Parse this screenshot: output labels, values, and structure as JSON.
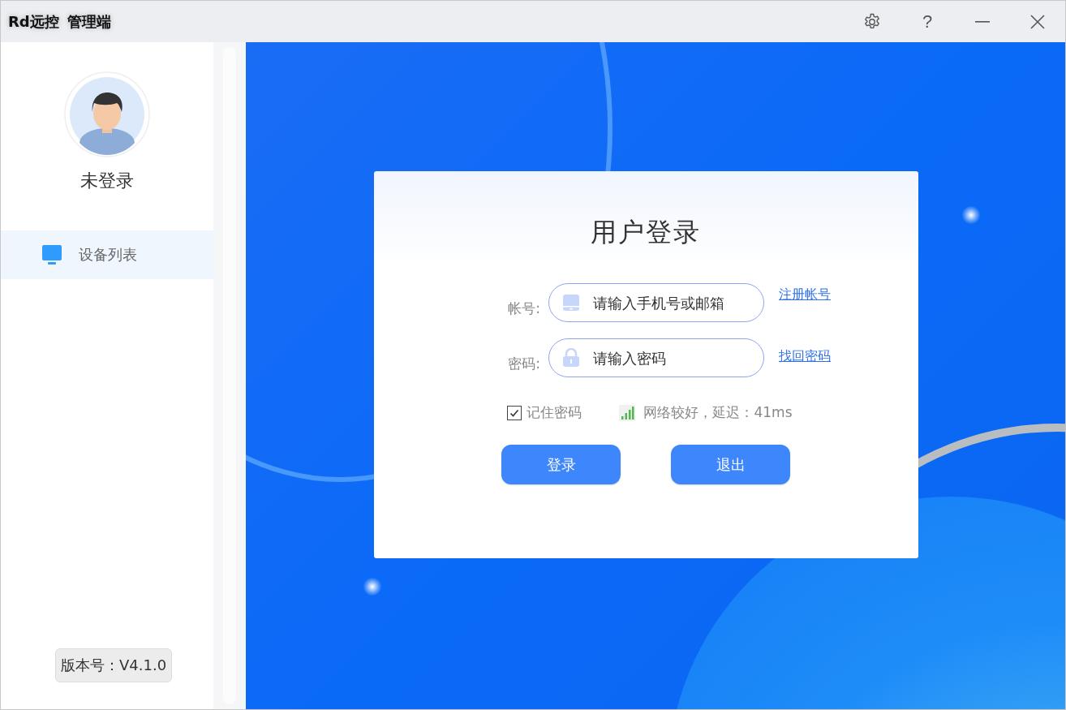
{
  "window": {
    "title_app": "Rd远控",
    "title_sub": "管理端",
    "help": "?"
  },
  "sidebar": {
    "user_status": "未登录",
    "items": [
      {
        "label": "设备列表",
        "selected": true
      }
    ],
    "version": "版本号：V4.1.0"
  },
  "login": {
    "title": "用户登录",
    "fields": [
      {
        "kind": "account",
        "label": "帐号:",
        "placeholder": "请输入手机号或邮箱",
        "link": "注册帐号"
      },
      {
        "kind": "password",
        "label": "密码:",
        "placeholder": "请输入密码",
        "link": "找回密码"
      }
    ],
    "remember": {
      "label": "记住密码",
      "checked": true
    },
    "network": "网络较好，延迟：41ms",
    "buttons": [
      "登录",
      "退出"
    ]
  }
}
